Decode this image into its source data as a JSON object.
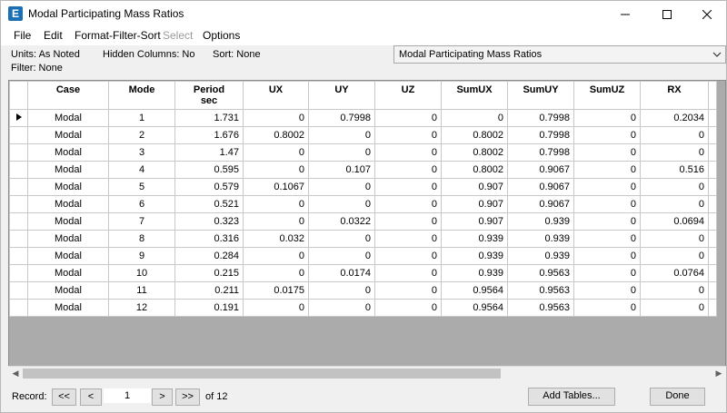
{
  "window": {
    "title": "Modal Participating Mass Ratios",
    "app_icon_letter": "E"
  },
  "menu": {
    "items": [
      {
        "label": "File",
        "enabled": true
      },
      {
        "label": "Edit",
        "enabled": true
      },
      {
        "label": "Format-Filter-Sort",
        "enabled": true
      },
      {
        "label": "Select",
        "enabled": false
      },
      {
        "label": "Options",
        "enabled": true
      }
    ]
  },
  "info": {
    "units": "Units:  As Noted",
    "hidden_columns": "Hidden Columns:  No",
    "sort": "Sort:  None",
    "filter": "Filter:  None"
  },
  "table_selector": {
    "selected": "Modal Participating Mass Ratios"
  },
  "table": {
    "columns": [
      {
        "key": "case",
        "label": "Case"
      },
      {
        "key": "mode",
        "label": "Mode"
      },
      {
        "key": "period",
        "label": "Period",
        "unit": "sec"
      },
      {
        "key": "ux",
        "label": "UX"
      },
      {
        "key": "uy",
        "label": "UY"
      },
      {
        "key": "uz",
        "label": "UZ"
      },
      {
        "key": "sumux",
        "label": "SumUX"
      },
      {
        "key": "sumuy",
        "label": "SumUY"
      },
      {
        "key": "sumuz",
        "label": "SumUZ"
      },
      {
        "key": "rx",
        "label": "RX"
      }
    ],
    "rows": [
      [
        "Modal",
        "1",
        "1.731",
        "0",
        "0.7998",
        "0",
        "0",
        "0.7998",
        "0",
        "0.2034"
      ],
      [
        "Modal",
        "2",
        "1.676",
        "0.8002",
        "0",
        "0",
        "0.8002",
        "0.7998",
        "0",
        "0"
      ],
      [
        "Modal",
        "3",
        "1.47",
        "0",
        "0",
        "0",
        "0.8002",
        "0.7998",
        "0",
        "0"
      ],
      [
        "Modal",
        "4",
        "0.595",
        "0",
        "0.107",
        "0",
        "0.8002",
        "0.9067",
        "0",
        "0.516"
      ],
      [
        "Modal",
        "5",
        "0.579",
        "0.1067",
        "0",
        "0",
        "0.907",
        "0.9067",
        "0",
        "0"
      ],
      [
        "Modal",
        "6",
        "0.521",
        "0",
        "0",
        "0",
        "0.907",
        "0.9067",
        "0",
        "0"
      ],
      [
        "Modal",
        "7",
        "0.323",
        "0",
        "0.0322",
        "0",
        "0.907",
        "0.939",
        "0",
        "0.0694"
      ],
      [
        "Modal",
        "8",
        "0.316",
        "0.032",
        "0",
        "0",
        "0.939",
        "0.939",
        "0",
        "0"
      ],
      [
        "Modal",
        "9",
        "0.284",
        "0",
        "0",
        "0",
        "0.939",
        "0.939",
        "0",
        "0"
      ],
      [
        "Modal",
        "10",
        "0.215",
        "0",
        "0.0174",
        "0",
        "0.939",
        "0.9563",
        "0",
        "0.0764"
      ],
      [
        "Modal",
        "11",
        "0.211",
        "0.0175",
        "0",
        "0",
        "0.9564",
        "0.9563",
        "0",
        "0"
      ],
      [
        "Modal",
        "12",
        "0.191",
        "0",
        "0",
        "0",
        "0.9564",
        "0.9563",
        "0",
        "0"
      ]
    ],
    "current_row_index": 0
  },
  "footer": {
    "record_label": "Record:",
    "first_label": "<<",
    "prev_label": "<",
    "record_value": "1",
    "next_label": ">",
    "last_label": ">>",
    "of_text": "of 12",
    "add_tables_label": "Add Tables...",
    "done_label": "Done"
  }
}
